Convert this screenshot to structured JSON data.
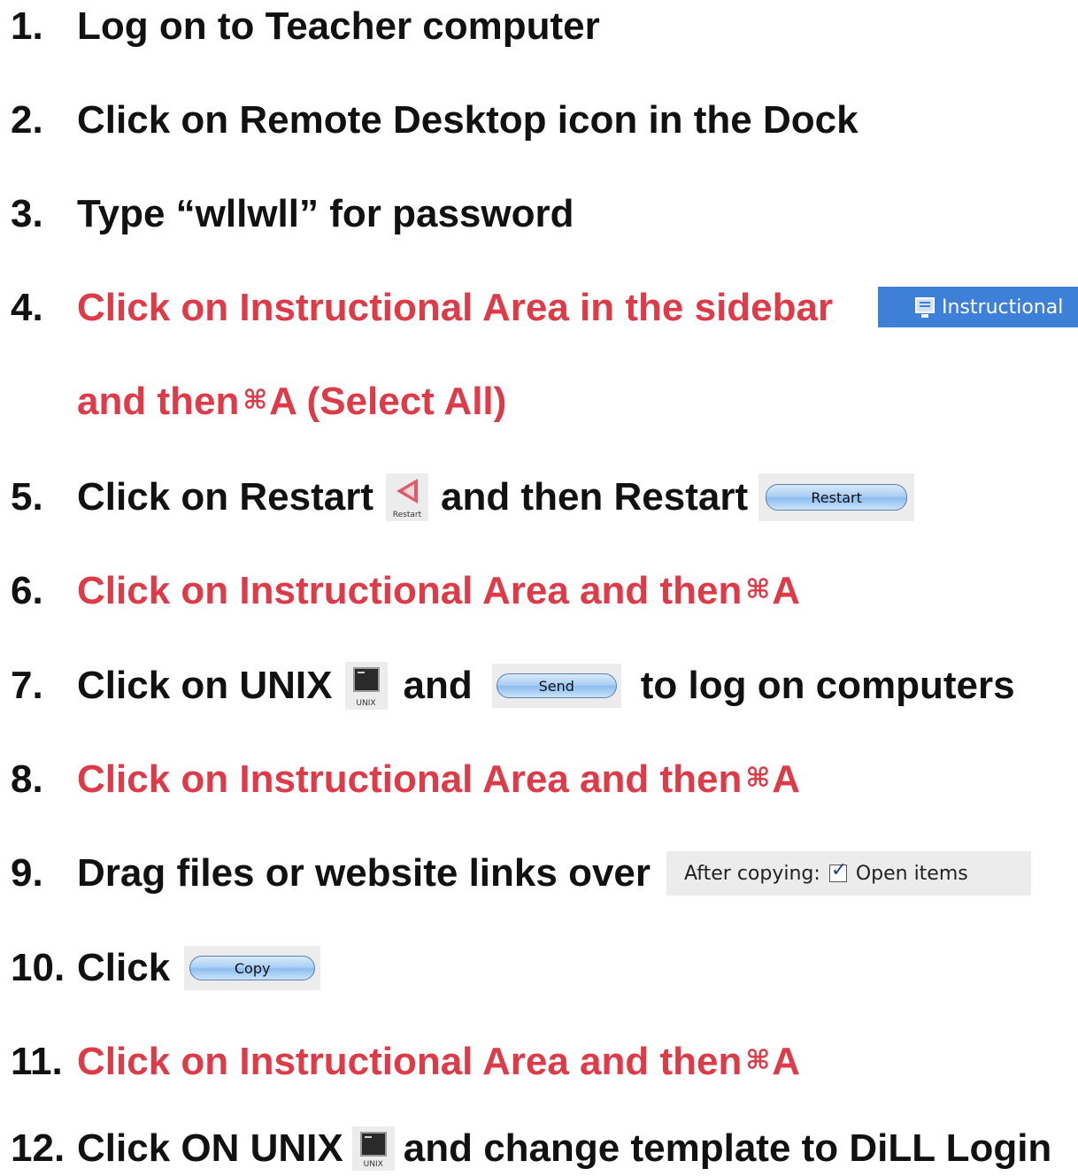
{
  "steps": [
    {
      "num": "1.",
      "text": "Log on to Teacher computer"
    },
    {
      "num": "2.",
      "text": "Click on Remote Desktop icon in the Dock"
    },
    {
      "num": "3.",
      "text": "Type “wllwll” for password"
    },
    {
      "num": "4.",
      "text": "Click on Instructional Area in the sidebar",
      "text_line2_pre": "and then ",
      "cmd": "⌘",
      "text_line2_post": "A (Select All)"
    },
    {
      "num": "5.",
      "text_pre": "Click on Restart",
      "text_mid": "and then Restart"
    },
    {
      "num": "6.",
      "text": "Click on Instructional Area and then ",
      "cmd": "⌘",
      "text_post": "A"
    },
    {
      "num": "7.",
      "text_pre": "Click on UNIX",
      "text_mid": "and",
      "text_post": "to log on computers"
    },
    {
      "num": "8.",
      "text": "Click on Instructional Area and then ",
      "cmd": "⌘",
      "text_post": "A"
    },
    {
      "num": "9.",
      "text": "Drag files or website links over"
    },
    {
      "num": "10.",
      "text": "Click"
    },
    {
      "num": "11.",
      "text": "Click on Instructional Area and then ",
      "cmd": "⌘",
      "text_post": "A"
    },
    {
      "num": "12.",
      "text_pre": "Click ON UNIX",
      "text_post": "and change template to DiLL Login"
    }
  ],
  "ui": {
    "sidebar_item_label": "Instructional",
    "restart_icon_caption": "Restart",
    "restart_button_label": "Restart",
    "unix_icon_caption": "UNIX",
    "send_button_label": "Send",
    "after_copying_label": "After copying:",
    "open_items_label": "Open items",
    "open_items_checked": true,
    "copy_button_label": "Copy"
  },
  "colors": {
    "text": "#111111",
    "highlight_red": "#de3a47",
    "sidebar_selection": "#3e7fd8",
    "aqua_button": "#a9cdf3"
  }
}
